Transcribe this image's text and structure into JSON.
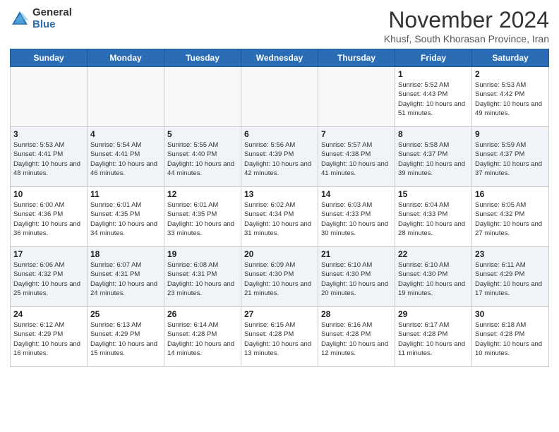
{
  "logo": {
    "general": "General",
    "blue": "Blue"
  },
  "title": "November 2024",
  "location": "Khusf, South Khorasan Province, Iran",
  "days_of_week": [
    "Sunday",
    "Monday",
    "Tuesday",
    "Wednesday",
    "Thursday",
    "Friday",
    "Saturday"
  ],
  "weeks": [
    [
      {
        "day": "",
        "info": ""
      },
      {
        "day": "",
        "info": ""
      },
      {
        "day": "",
        "info": ""
      },
      {
        "day": "",
        "info": ""
      },
      {
        "day": "",
        "info": ""
      },
      {
        "day": "1",
        "info": "Sunrise: 5:52 AM\nSunset: 4:43 PM\nDaylight: 10 hours and 51 minutes."
      },
      {
        "day": "2",
        "info": "Sunrise: 5:53 AM\nSunset: 4:42 PM\nDaylight: 10 hours and 49 minutes."
      }
    ],
    [
      {
        "day": "3",
        "info": "Sunrise: 5:53 AM\nSunset: 4:41 PM\nDaylight: 10 hours and 48 minutes."
      },
      {
        "day": "4",
        "info": "Sunrise: 5:54 AM\nSunset: 4:41 PM\nDaylight: 10 hours and 46 minutes."
      },
      {
        "day": "5",
        "info": "Sunrise: 5:55 AM\nSunset: 4:40 PM\nDaylight: 10 hours and 44 minutes."
      },
      {
        "day": "6",
        "info": "Sunrise: 5:56 AM\nSunset: 4:39 PM\nDaylight: 10 hours and 42 minutes."
      },
      {
        "day": "7",
        "info": "Sunrise: 5:57 AM\nSunset: 4:38 PM\nDaylight: 10 hours and 41 minutes."
      },
      {
        "day": "8",
        "info": "Sunrise: 5:58 AM\nSunset: 4:37 PM\nDaylight: 10 hours and 39 minutes."
      },
      {
        "day": "9",
        "info": "Sunrise: 5:59 AM\nSunset: 4:37 PM\nDaylight: 10 hours and 37 minutes."
      }
    ],
    [
      {
        "day": "10",
        "info": "Sunrise: 6:00 AM\nSunset: 4:36 PM\nDaylight: 10 hours and 36 minutes."
      },
      {
        "day": "11",
        "info": "Sunrise: 6:01 AM\nSunset: 4:35 PM\nDaylight: 10 hours and 34 minutes."
      },
      {
        "day": "12",
        "info": "Sunrise: 6:01 AM\nSunset: 4:35 PM\nDaylight: 10 hours and 33 minutes."
      },
      {
        "day": "13",
        "info": "Sunrise: 6:02 AM\nSunset: 4:34 PM\nDaylight: 10 hours and 31 minutes."
      },
      {
        "day": "14",
        "info": "Sunrise: 6:03 AM\nSunset: 4:33 PM\nDaylight: 10 hours and 30 minutes."
      },
      {
        "day": "15",
        "info": "Sunrise: 6:04 AM\nSunset: 4:33 PM\nDaylight: 10 hours and 28 minutes."
      },
      {
        "day": "16",
        "info": "Sunrise: 6:05 AM\nSunset: 4:32 PM\nDaylight: 10 hours and 27 minutes."
      }
    ],
    [
      {
        "day": "17",
        "info": "Sunrise: 6:06 AM\nSunset: 4:32 PM\nDaylight: 10 hours and 25 minutes."
      },
      {
        "day": "18",
        "info": "Sunrise: 6:07 AM\nSunset: 4:31 PM\nDaylight: 10 hours and 24 minutes."
      },
      {
        "day": "19",
        "info": "Sunrise: 6:08 AM\nSunset: 4:31 PM\nDaylight: 10 hours and 23 minutes."
      },
      {
        "day": "20",
        "info": "Sunrise: 6:09 AM\nSunset: 4:30 PM\nDaylight: 10 hours and 21 minutes."
      },
      {
        "day": "21",
        "info": "Sunrise: 6:10 AM\nSunset: 4:30 PM\nDaylight: 10 hours and 20 minutes."
      },
      {
        "day": "22",
        "info": "Sunrise: 6:10 AM\nSunset: 4:30 PM\nDaylight: 10 hours and 19 minutes."
      },
      {
        "day": "23",
        "info": "Sunrise: 6:11 AM\nSunset: 4:29 PM\nDaylight: 10 hours and 17 minutes."
      }
    ],
    [
      {
        "day": "24",
        "info": "Sunrise: 6:12 AM\nSunset: 4:29 PM\nDaylight: 10 hours and 16 minutes."
      },
      {
        "day": "25",
        "info": "Sunrise: 6:13 AM\nSunset: 4:29 PM\nDaylight: 10 hours and 15 minutes."
      },
      {
        "day": "26",
        "info": "Sunrise: 6:14 AM\nSunset: 4:28 PM\nDaylight: 10 hours and 14 minutes."
      },
      {
        "day": "27",
        "info": "Sunrise: 6:15 AM\nSunset: 4:28 PM\nDaylight: 10 hours and 13 minutes."
      },
      {
        "day": "28",
        "info": "Sunrise: 6:16 AM\nSunset: 4:28 PM\nDaylight: 10 hours and 12 minutes."
      },
      {
        "day": "29",
        "info": "Sunrise: 6:17 AM\nSunset: 4:28 PM\nDaylight: 10 hours and 11 minutes."
      },
      {
        "day": "30",
        "info": "Sunrise: 6:18 AM\nSunset: 4:28 PM\nDaylight: 10 hours and 10 minutes."
      }
    ]
  ]
}
